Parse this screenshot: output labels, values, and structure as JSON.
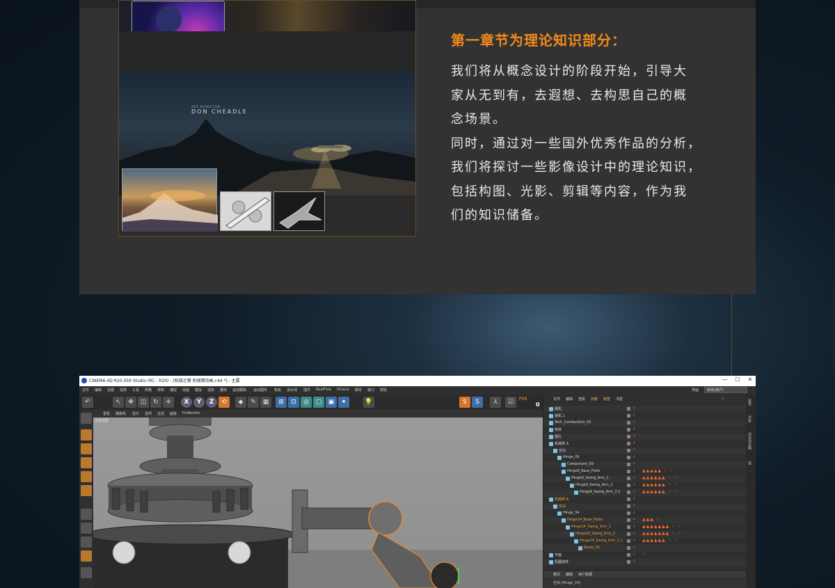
{
  "chapter": {
    "heading": "第一章节为理论知识部分：",
    "lines": [
      "我们将从概念设计的阶段开始，引导大",
      "家从无到有，去遐想、去构思自己的概",
      "念场景。",
      "同时，通过对一些国外优秀作品的分析，",
      "我们将探讨一些影像设计中的理论知识，",
      "包括构图、光影、剪辑等内容，作为我",
      "们的知识储备。"
    ]
  },
  "collage": {
    "credit_small": "ART DIRECTOR",
    "credit_name": "DON CHEADLE"
  },
  "app": {
    "title": "CINEMA 4D R20.059 Studio (RC - R20) - [机械之臂 机械臂动画.c4d *] - 主要",
    "window_controls": [
      "—",
      "☐",
      "✕"
    ],
    "menu": [
      "文件",
      "编辑",
      "创建",
      "选择",
      "工具",
      "网格",
      "体积",
      "捕捉",
      "动画",
      "模拟",
      "渲染",
      "雕刻",
      "运动跟踪",
      "运动图形",
      "角色",
      "流水线",
      "插件",
      "RealFlow",
      "Octane",
      "脚本",
      "窗口",
      "帮助"
    ],
    "layout_label": "界面",
    "layout_value": "启动(用户)",
    "toolbar": [
      "↶",
      "↖",
      "✥",
      "◫",
      "↻",
      "✛",
      "X",
      "Y",
      "Z",
      "⟲",
      "◆",
      "✎",
      "▦",
      "⊞",
      "⊡",
      "◎",
      "▢",
      "▣",
      "✦",
      "💡",
      "S",
      "S",
      "⅄",
      "☑",
      "PSR",
      "0"
    ],
    "viewport": {
      "menu": [
        "查看",
        "摄像机",
        "显示",
        "选项",
        "过滤",
        "面板",
        "ProRender"
      ],
      "label": "透视视图"
    },
    "object_manager": {
      "tabs": [
        "文件",
        "编辑",
        "查看",
        "对象",
        "标签",
        "书签"
      ],
      "rows": [
        {
          "name": "摄机",
          "indent": 0,
          "tags": ""
        },
        {
          "name": "摄机.1",
          "indent": 0,
          "tags": ""
        },
        {
          "name": "Tech_Combustion_02",
          "indent": 0,
          "tags": ""
        },
        {
          "name": "売体",
          "indent": 0,
          "tags": "",
          "x": true
        },
        {
          "name": "摄孔",
          "indent": 0,
          "tags": "",
          "x": true
        },
        {
          "name": "机械臂 A",
          "indent": 0,
          "tags": "",
          "x": true
        },
        {
          "name": "空白",
          "indent": 1,
          "tags": ""
        },
        {
          "name": "Hinge_09",
          "indent": 2,
          "tags": ""
        },
        {
          "name": "Component_09",
          "indent": 3,
          "tags": ""
        },
        {
          "name": "Hinge9_Base_Plate",
          "indent": 3,
          "tags": "▲▲▲▲▲ ⁘ ⁘"
        },
        {
          "name": "Hinge9_Swing_Arm_1",
          "indent": 4,
          "tags": "▲▲▲▲▲▲ ⁘ ⁘"
        },
        {
          "name": "Hinge9_Swing_Arm_2",
          "indent": 5,
          "tags": "▲▲▲▲▲▲ ⁘ ⁘"
        },
        {
          "name": "Hinge9_Swing_Arm_2.1",
          "indent": 6,
          "tags": "▲▲▲▲▲▲ ⁘ ⁘"
        },
        {
          "name": "机械臂 B",
          "indent": 0,
          "tags": "",
          "x": true,
          "sel": true
        },
        {
          "name": "空白",
          "indent": 1,
          "tags": "",
          "sel": true
        },
        {
          "name": "Hinge_34",
          "indent": 2,
          "tags": ""
        },
        {
          "name": "Hinge14_Base_Plate",
          "indent": 3,
          "tags": "▲▲▲ ⁘",
          "sel": true
        },
        {
          "name": "Hinge14_Swing_Arm_1",
          "indent": 4,
          "tags": "▲▲▲▲▲▲▲ ⁘ ⁘",
          "sel": true
        },
        {
          "name": "Hinge14_Swing_Arm_2",
          "indent": 5,
          "tags": "▲▲▲▲▲▲▲ ⁘ ⁘",
          "sel": true
        },
        {
          "name": "Hinge14_Swing_Arm_2.1",
          "indent": 6,
          "tags": "▲▲▲▲▲▲ ⁘ ⁘",
          "sel": true
        },
        {
          "name": "Beam_01",
          "indent": 7,
          "tags": "",
          "sel": true
        },
        {
          "name": "平面",
          "indent": 0,
          "tags": "⁘"
        },
        {
          "name": "机器连体",
          "indent": 0,
          "tags": ""
        }
      ],
      "attr_tabs": [
        "模式",
        "编辑",
        "用户数据"
      ],
      "attr_title": "空白 [Hinge_14]"
    },
    "side_tabs": [
      "属性",
      "对象",
      "内容浏览器",
      "层"
    ]
  },
  "colors": {
    "accent": "#f28a1b",
    "panel": "#323232",
    "selected": "#f2a03a"
  }
}
